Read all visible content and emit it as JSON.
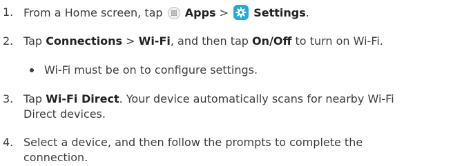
{
  "steps": [
    {
      "num": "1.",
      "pre": "From a Home screen, tap",
      "apps_label": "Apps",
      "sep": ">",
      "settings_label": "Settings",
      "end": ".",
      "icons": [
        "apps-icon",
        "settings-icon"
      ]
    },
    {
      "num": "2.",
      "pre": "Tap",
      "b1": "Connections",
      "sep": ">",
      "b2": "Wi-Fi",
      "mid": ", and then tap",
      "b3": "On/Off",
      "end": "to turn on Wi-Fi."
    },
    {
      "bullet": "Wi-Fi must be on to configure settings."
    },
    {
      "num": "3.",
      "pre": "Tap",
      "b1": "Wi-Fi Direct",
      "line1_end": ". Your device automatically scans for nearby Wi-Fi",
      "line2": "Direct devices."
    },
    {
      "num": "4.",
      "line1": "Select a device, and then follow the prompts to complete the",
      "line2": "connection."
    }
  ],
  "colors": {
    "text": "#3c3c3c",
    "bold": "#222222",
    "settings_icon_bg": "#2aa7dc"
  }
}
